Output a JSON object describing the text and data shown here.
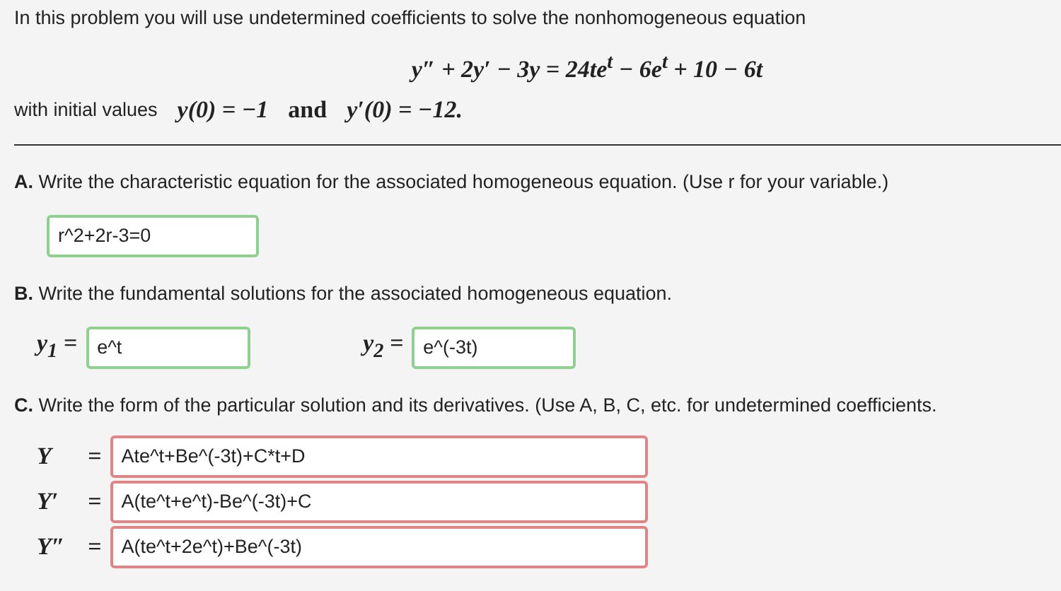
{
  "intro": "In this problem you will use undetermined coefficients to solve the nonhomogeneous equation",
  "equation": "y″ + 2y′ − 3y = 24te$^{t}$ − 6e$^{t}$ + 10 − 6t",
  "initial_values": {
    "label": "with initial values",
    "first": "y(0) = −1",
    "joiner": "and",
    "second": "y′(0) = −12."
  },
  "part_a": {
    "letter": "A.",
    "prompt": "Write the characteristic equation for the associated homogeneous equation. (Use r for your variable.)",
    "fields": [
      {
        "value": "r^2+2r-3=0",
        "correct": true
      }
    ]
  },
  "part_b": {
    "letter": "B.",
    "prompt": "Write the fundamental solutions for the associated homogeneous equation.",
    "fields": [
      {
        "label": "y$_{1}$ =",
        "value": "e^t",
        "correct": true
      },
      {
        "label": "y$_{2}$ =",
        "value": "e^(-3t)",
        "correct": true
      }
    ]
  },
  "part_c": {
    "letter": "C.",
    "prompt": "Write the form of the particular solution and its derivatives. (Use A, B, C, etc. for undetermined coefficients.",
    "fields": [
      {
        "label": "Y",
        "sign": "=",
        "value": "Ate^t+Be^(-3t)+C*t+D",
        "correct": false
      },
      {
        "label": "Y′",
        "sign": "=",
        "value": "A(te^t+e^t)-Be^(-3t)+C",
        "correct": false
      },
      {
        "label": "Y″",
        "sign": "=",
        "value": "A(te^t+2e^t)+Be^(-3t)",
        "correct": false
      }
    ]
  }
}
